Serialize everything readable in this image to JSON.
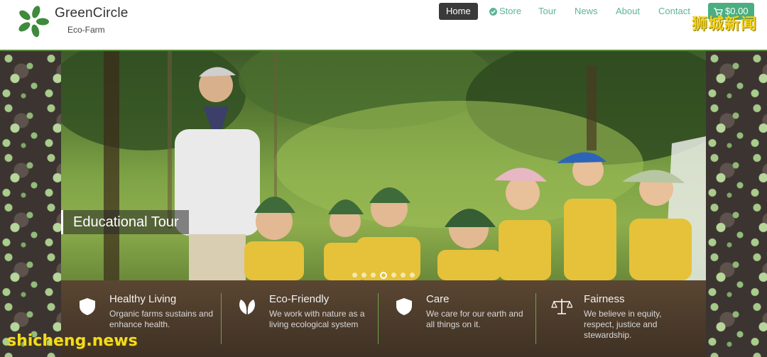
{
  "brand": {
    "name": "GreenCircle",
    "subtitle": "Eco-Farm"
  },
  "nav": {
    "items": [
      {
        "label": "Home",
        "active": true
      },
      {
        "label": "Store",
        "icon": "check-circle-icon"
      },
      {
        "label": "Tour"
      },
      {
        "label": "News"
      },
      {
        "label": "About"
      },
      {
        "label": "Contact"
      }
    ],
    "cart": {
      "label": "$0.00",
      "icon": "cart-icon"
    }
  },
  "hero": {
    "caption": "Educational Tour",
    "slides_total": 7,
    "active_slide": 3
  },
  "features": [
    {
      "icon": "shield-icon",
      "title": "Healthy Living",
      "desc": "Organic farms sustains and enhance health."
    },
    {
      "icon": "leaf-icon",
      "title": "Eco-Friendly",
      "desc": "We work with nature as a living ecological system"
    },
    {
      "icon": "shield-icon",
      "title": "Care",
      "desc": "We care for our earth and all things on it."
    },
    {
      "icon": "balance-scale-icon",
      "title": "Fairness",
      "desc": "We believe in equity, respect, justice and stewardship."
    }
  ],
  "watermarks": {
    "top_right": "狮城新闻",
    "bottom_left": "shicheng.news"
  },
  "colors": {
    "accent": "#5fb39a",
    "cart": "#4bae80",
    "feature_bar": "#4a3a2b",
    "divider": "#6fa34a"
  }
}
